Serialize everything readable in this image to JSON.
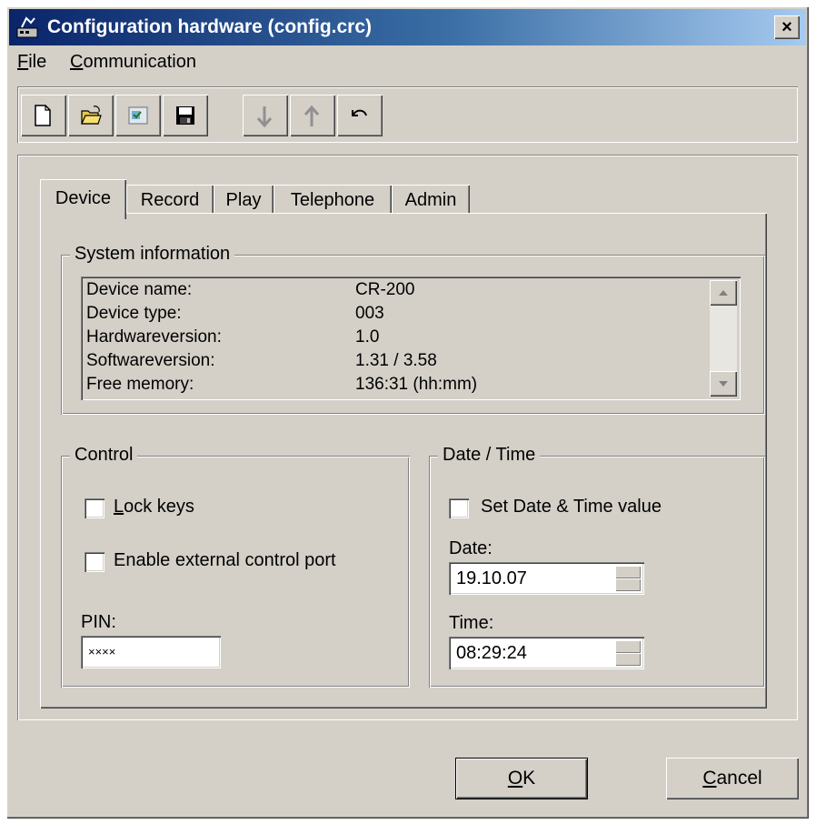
{
  "window": {
    "title": "Configuration hardware (config.crc)",
    "close_label": "×"
  },
  "menu": {
    "file_acc": "F",
    "file_rest": "ile",
    "comm_acc": "C",
    "comm_rest": "ommunication"
  },
  "toolbar": {
    "buttons": [
      "new-icon",
      "open-folder-icon",
      "properties-icon",
      "save-icon",
      "arrow-down-icon",
      "arrow-up-icon",
      "undo-icon"
    ]
  },
  "tabs": [
    {
      "label": "Device",
      "active": true
    },
    {
      "label": "Record"
    },
    {
      "label": "Play"
    },
    {
      "label": "Telephone"
    },
    {
      "label": "Admin"
    }
  ],
  "system_info": {
    "title": "System information",
    "rows": [
      {
        "label": "Device name:",
        "value": "CR-200"
      },
      {
        "label": "Device type:",
        "value": "003"
      },
      {
        "label": "Hardwareversion:",
        "value": "1.0"
      },
      {
        "label": "Softwareversion:",
        "value": "1.31 / 3.58"
      },
      {
        "label": "Free memory:",
        "value": "136:31 (hh:mm)"
      }
    ]
  },
  "control": {
    "title": "Control",
    "lock_keys_acc": "L",
    "lock_keys_rest": "ock keys",
    "lock_keys_checked": false,
    "ext_port_label": "Enable external control port",
    "ext_port_checked": false,
    "pin_label": "PIN:",
    "pin_value": "××××"
  },
  "datetime": {
    "title": "Date / Time",
    "set_label": "Set Date & Time value",
    "set_checked": false,
    "date_label": "Date:",
    "date_value": "19.10.07",
    "time_label": "Time:",
    "time_value": "08:29:24"
  },
  "buttons": {
    "ok_acc": "O",
    "ok_rest": "K",
    "cancel_acc": "C",
    "cancel_rest": "ancel"
  },
  "colors": {
    "face": "#d4d0c8",
    "title_start": "#0a246a",
    "title_end": "#a6caf0"
  }
}
